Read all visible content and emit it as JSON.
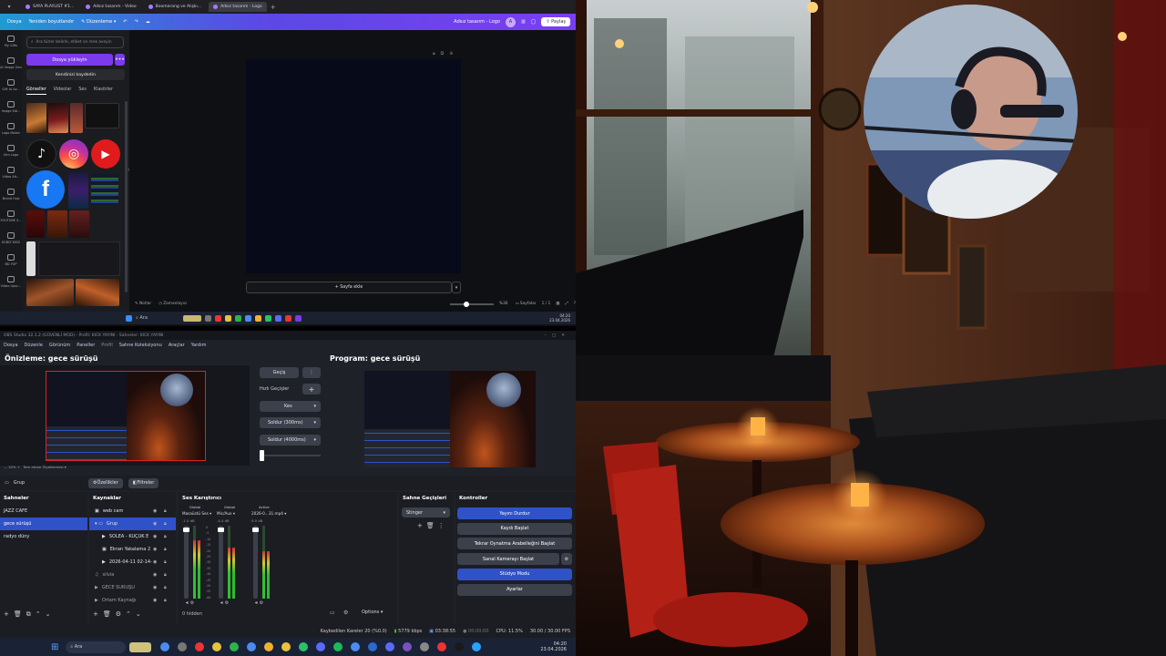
{
  "canva": {
    "tabs": [
      {
        "label": "SAYA PLAYLIST #1...",
        "active": false
      },
      {
        "label": "Adsız tasarım - Video",
        "active": false
      },
      {
        "label": "Boomerang ve Alışkı...",
        "active": false
      },
      {
        "label": "Adsız tasarım - Logo",
        "active": true
      }
    ],
    "header": {
      "home": "Dosya",
      "resize": "Yeniden boyutlandır",
      "edit_mode": "Düzenleme",
      "doc_title": "Adsız tasarım - Logo",
      "avatar_initial": "A",
      "share": "Paylaş"
    },
    "rail": [
      "My Gifts",
      "AI Image Gen",
      "Gift AI Av...",
      "Image Edi...",
      "Logo Maker",
      "Gen Logo",
      "Video Alt...",
      "Brand Hub",
      "YOUTUBE S...",
      "KOBIZ MOD",
      "BD YOP",
      "Video Upsc..."
    ],
    "panel": {
      "search_placeholder": "Ara türler belirle, etiket ve renk aveyin",
      "upload": "Dosya yükleyin",
      "more": "•••",
      "record": "Kendinizi kaydedin",
      "tabs": [
        "Görseller",
        "Videolar",
        "Ses",
        "Klasörler"
      ],
      "social_icons": [
        "tiktok-icon",
        "instagram-icon",
        "youtube-icon",
        "facebook-icon"
      ]
    },
    "add_page": "+ Sayfa ekle",
    "footer": {
      "notes": "Notlar",
      "timer": "Zamanlayıcı",
      "zoom": "%36",
      "pages_label": "Sayfalar",
      "pages": "1 / 1"
    },
    "taskbar_search": "Ara",
    "taskbar_time": "04:20",
    "taskbar_date": "23.04.2026",
    "zoom_level": 0.35
  },
  "obs": {
    "title": "OBS Studio 32.1.2 (GÜVENLİ MOD) - Profil: KICK YAYINI - Sahneler: KICK YAYINI",
    "menu": [
      "Dosya",
      "Düzenle",
      "Görünüm",
      "Paneller",
      "Profil",
      "Sahne Koleksiyonu",
      "Araçlar",
      "Yardım"
    ],
    "preview_label": "Önizleme: gece sürüşü",
    "program_label": "Program: gece sürüşü",
    "transition_btn": "Geçiş",
    "quick_transitions": "Hızlı Geçişler",
    "transitions": [
      "Kes",
      "Soldur (300ms)",
      "Soldur (4000ms)"
    ],
    "zoom_label": "19%",
    "preview_scale": "Tam ekran Ölçeklemesi",
    "group_label": "Grup",
    "properties_btn": "Özellikler",
    "filters_btn": "Filtreler",
    "scenes": {
      "title": "Sahneler",
      "items": [
        "JAZZ CAFE",
        "gece sürüşü",
        "radyo düny"
      ],
      "selected": 1
    },
    "sources": {
      "title": "Kaynaklar",
      "items": [
        {
          "label": "web cam",
          "indent": 0
        },
        {
          "label": "Grup",
          "indent": 0
        },
        {
          "label": "SOLEA - KÜÇÜK E",
          "indent": 1
        },
        {
          "label": "Ekran Yakalama 2",
          "indent": 1
        },
        {
          "label": "2026-04-11 02-14-",
          "indent": 1
        },
        {
          "label": "silvia",
          "indent": 0
        },
        {
          "label": "GECE SÜRÜŞÜ",
          "indent": 0
        },
        {
          "label": "Ortam Kaynağı",
          "indent": 0
        }
      ]
    },
    "mixer": {
      "title": "Ses Karıştırıcı",
      "channels": [
        {
          "tag": "Global",
          "name": "Masaüstü Ses",
          "db": "-1.0 dB"
        },
        {
          "tag": "Global",
          "name": "Mic/Aux",
          "db": "-4.4 dB"
        },
        {
          "tag": "Active",
          "name": "2026-0...31.mp4",
          "db": "0.0 dB"
        }
      ],
      "scale": [
        "0",
        "-5",
        "-10",
        "-15",
        "-20",
        "-25",
        "-30",
        "-35",
        "-40",
        "-45",
        "-50",
        "-55",
        "-60"
      ],
      "hidden": "0 hidden",
      "options": "Options"
    },
    "scene_transitions": {
      "title": "Sahne Geçişleri",
      "current": "Stinger"
    },
    "controls": {
      "title": "Kontroller",
      "buttons": [
        {
          "label": "Yayını Durdur",
          "active": true
        },
        {
          "label": "Kaydı Başlat",
          "active": false
        },
        {
          "label": "Tekrar Oynatma Arabelleğini Başlat",
          "active": false
        },
        {
          "label": "Sanal Kamerayı Başlat",
          "active": false
        },
        {
          "label": "Stüdyo Modu",
          "active": true
        },
        {
          "label": "Ayarlar",
          "active": false
        }
      ]
    },
    "status": {
      "dropped": "Kaybedilen Kareler 20 (%0.0)",
      "bitrate": "5779 kbps",
      "stream_time": "03:38:55",
      "rec_time": "00:00:00",
      "cpu": "CPU: 11.5%",
      "fps": "30.00 / 30.00 FPS"
    }
  },
  "taskbar": {
    "search": "Ara",
    "time": "04:20",
    "date": "23.04.2026"
  },
  "colors": {
    "obs_accent": "#2f52c9",
    "canva_purple": "#7c3aed",
    "preview_border": "#e02020"
  }
}
